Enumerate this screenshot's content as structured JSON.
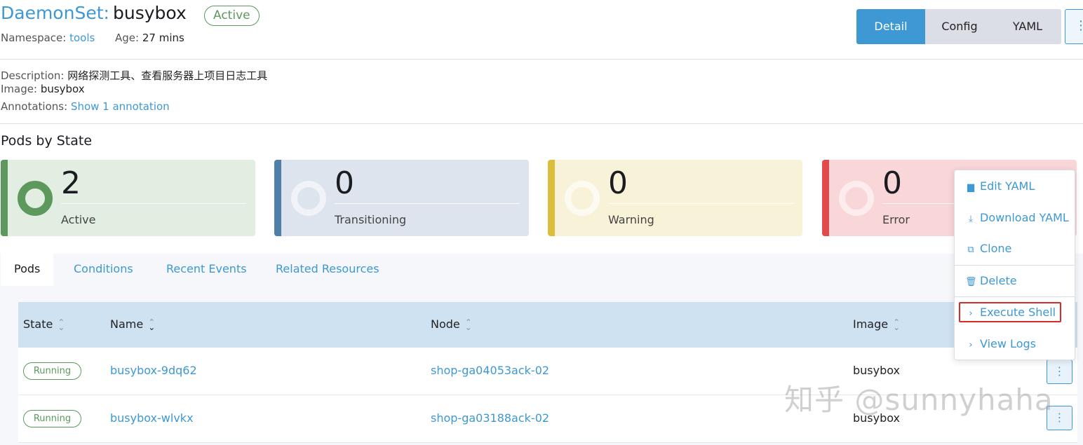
{
  "header": {
    "resource_type": "DaemonSet:",
    "resource_name": "busybox",
    "status": "Active",
    "namespace_label": "Namespace:",
    "namespace_value": "tools",
    "age_label": "Age:",
    "age_value": "27 mins"
  },
  "view_modes": [
    "Detail",
    "Config",
    "YAML"
  ],
  "selected_view": "Detail",
  "details": {
    "description_label": "Description:",
    "description_value": "网络探测工具、查看服务器上项目日志工具",
    "image_label": "Image:",
    "image_value": "busybox",
    "annotations_label": "Annotations:",
    "annotations_link": "Show 1 annotation"
  },
  "pods_by_state": {
    "title": "Pods by State",
    "cards": [
      {
        "count": "2",
        "label": "Active",
        "color": "#5d995d"
      },
      {
        "count": "0",
        "label": "Transitioning",
        "color": "#4e7fa8"
      },
      {
        "count": "0",
        "label": "Warning",
        "color": "#dcbe3c"
      },
      {
        "count": "0",
        "label": "Error",
        "color": "#e14b4b"
      }
    ]
  },
  "tabs": [
    "Pods",
    "Conditions",
    "Recent Events",
    "Related Resources"
  ],
  "selected_tab": "Pods",
  "table": {
    "columns": [
      "State",
      "Name",
      "Node",
      "Image"
    ],
    "rows": [
      {
        "state": "Running",
        "name": "busybox-9dq62",
        "node": "shop-ga04053ack-02",
        "image": "busybox"
      },
      {
        "state": "Running",
        "name": "busybox-wlvkx",
        "node": "shop-ga03188ack-02",
        "image": "busybox"
      }
    ]
  },
  "action_menu": {
    "items": [
      {
        "label": "Edit YAML",
        "icon": "file-icon"
      },
      {
        "label": "Download YAML",
        "icon": "download-icon"
      },
      {
        "label": "Clone",
        "icon": "copy-icon"
      },
      {
        "label": "Delete",
        "icon": "trash-icon"
      },
      {
        "label": "Execute Shell",
        "icon": "chevron-right-icon"
      },
      {
        "label": "View Logs",
        "icon": "chevron-right-icon"
      }
    ],
    "highlighted_item": "Execute Shell"
  },
  "watermark": "知乎 @sunnyhaha",
  "colors": {
    "link": "#3d98d3",
    "active": "#5d995d",
    "header_bg": "#cfe2f2",
    "highlight": "#d52b2b"
  }
}
